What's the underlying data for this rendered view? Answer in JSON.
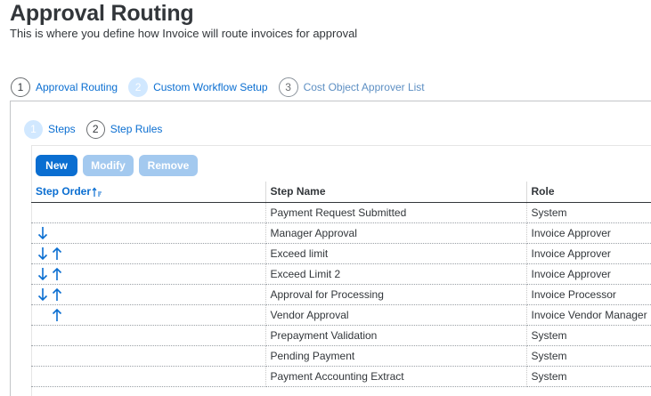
{
  "header": {
    "title": "Approval Routing",
    "subtitle": "This is where you define how Invoice will route invoices for approval"
  },
  "wizard": {
    "steps": [
      {
        "number": "1",
        "label": "Approval Routing"
      },
      {
        "number": "2",
        "label": "Custom Workflow Setup"
      },
      {
        "number": "3",
        "label": "Cost Object Approver List"
      }
    ]
  },
  "subtabs": [
    {
      "number": "1",
      "label": "Steps"
    },
    {
      "number": "2",
      "label": "Step Rules"
    }
  ],
  "toolbar": {
    "new_label": "New",
    "modify_label": "Modify",
    "remove_label": "Remove"
  },
  "table": {
    "columns": {
      "order": "Step Order",
      "name": "Step Name",
      "role": "Role"
    },
    "rows": [
      {
        "name": "Payment Request Submitted",
        "role": "System",
        "down": false,
        "up": false
      },
      {
        "name": "Manager Approval",
        "role": "Invoice Approver",
        "down": true,
        "up": false
      },
      {
        "name": "Exceed limit",
        "role": "Invoice Approver",
        "down": true,
        "up": true
      },
      {
        "name": "Exceed Limit 2",
        "role": "Invoice Approver",
        "down": true,
        "up": true
      },
      {
        "name": "Approval for Processing",
        "role": "Invoice Processor",
        "down": true,
        "up": true
      },
      {
        "name": "Vendor Approval",
        "role": "Invoice Vendor Manager",
        "down": false,
        "up": true
      },
      {
        "name": "Prepayment Validation",
        "role": "System",
        "down": false,
        "up": false
      },
      {
        "name": "Pending Payment",
        "role": "System",
        "down": false,
        "up": false
      },
      {
        "name": "Payment Accounting Extract",
        "role": "System",
        "down": false,
        "up": false
      }
    ]
  },
  "colors": {
    "accent": "#0a6ed1",
    "accent_disabled": "#a3c9ef",
    "text": "#32363a"
  },
  "icons": {
    "down": "arrow-down-icon",
    "up": "arrow-up-icon",
    "sort": "sort-ascending-icon"
  }
}
